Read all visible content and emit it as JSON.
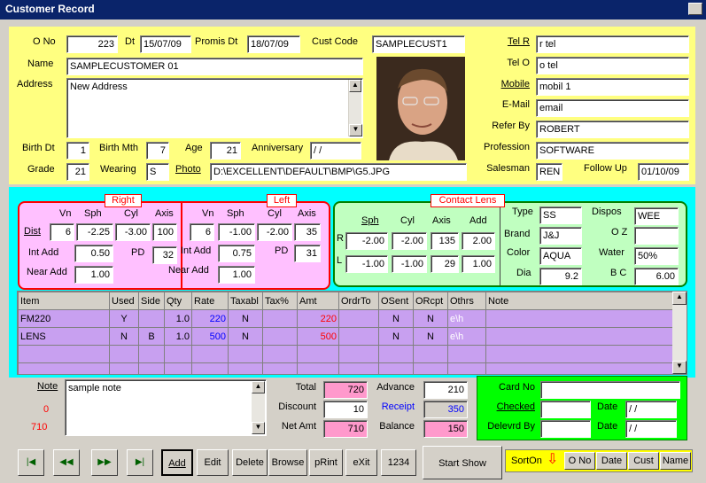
{
  "window": {
    "title": "Customer Record"
  },
  "header": {
    "ono_label": "O No",
    "ono": "223",
    "dt_label": "Dt",
    "dt": "15/07/09",
    "promis_label": "Promis Dt",
    "promis": "18/07/09",
    "cust_code_label": "Cust Code",
    "cust_code": "SAMPLECUST1",
    "name_label": "Name",
    "name": "SAMPLECUSTOMER 01",
    "address_label": "Address",
    "address": "New Address",
    "birth_dt_label": "Birth Dt",
    "birth_dt": "1",
    "birth_mth_label": "Birth Mth",
    "birth_mth": "7",
    "age_label": "Age",
    "age": "21",
    "anniversary_label": "Anniversary",
    "anniversary": " / /",
    "grade_label": "Grade",
    "grade": "21",
    "wearing_label": "Wearing",
    "wearing": "S",
    "photo_label": "Photo",
    "photo": "D:\\EXCELLENT\\DEFAULT\\BMP\\G5.JPG",
    "tel_r_label": "Tel R",
    "tel_r": "r tel",
    "tel_o_label": "Tel O",
    "tel_o": "o tel",
    "mobile_label": "Mobile",
    "mobile": "mobil 1",
    "email_label": "E-Mail",
    "email": "email",
    "refer_label": "Refer By",
    "refer": "ROBERT",
    "profession_label": "Profession",
    "profession": "SOFTWARE",
    "salesman_label": "Salesman",
    "salesman": "REN",
    "follow_label": "Follow Up",
    "follow": "01/10/09"
  },
  "rx": {
    "right_title": "Right",
    "left_title": "Left",
    "cols": [
      "Vn",
      "Sph",
      "Cyl",
      "Axis"
    ],
    "dist_label": "Dist",
    "intadd_label": "Int Add",
    "nearadd_label": "Near Add",
    "pd_label": "PD",
    "right": {
      "vn": "6",
      "sph": "-2.25",
      "cyl": "-3.00",
      "axis": "100",
      "intadd": "0.50",
      "pd": "32",
      "nearadd": "1.00"
    },
    "left": {
      "vn": "6",
      "sph": "-1.00",
      "cyl": "-2.00",
      "axis": "35",
      "intadd": "0.75",
      "pd": "31",
      "nearadd": "1.00"
    }
  },
  "contact": {
    "title": "Contact Lens",
    "cols": [
      "Sph",
      "Cyl",
      "Axis",
      "Add"
    ],
    "r_label": "R",
    "l_label": "L",
    "r": {
      "sph": "-2.00",
      "cyl": "-2.00",
      "axis": "135",
      "add": "2.00"
    },
    "l": {
      "sph": "-1.00",
      "cyl": "-1.00",
      "axis": "29",
      "add": "1.00"
    },
    "type_label": "Type",
    "type": "SS",
    "brand_label": "Brand",
    "brand": "J&J",
    "color_label": "Color",
    "color": "AQUA",
    "dia_label": "Dia",
    "dia": "9.2",
    "dispos_label": "Dispos",
    "dispos": "WEE",
    "oz_label": "O Z",
    "oz": "",
    "water_label": "Water",
    "water": "50%",
    "bc_label": "B C",
    "bc": "6.00"
  },
  "items": {
    "headers": [
      "Item",
      "Used",
      "Side",
      "Qty",
      "Rate",
      "Taxabl",
      "Tax%",
      "Amt",
      "OrdrTo",
      "OSent",
      "ORcpt",
      "Othrs",
      "Note"
    ],
    "rows": [
      [
        "FM220",
        "Y",
        "",
        "1.0",
        "220",
        "N",
        "",
        "220",
        "",
        "N",
        "N",
        "e\\h",
        ""
      ],
      [
        "LENS",
        "N",
        "B",
        "1.0",
        "500",
        "N",
        "",
        "500",
        "",
        "N",
        "N",
        "e\\h",
        ""
      ]
    ]
  },
  "footer": {
    "note_label": "Note",
    "note": "sample note",
    "count1": "0",
    "count2": "710",
    "total_label": "Total",
    "total": "720",
    "discount_label": "Discount",
    "discount": "10",
    "netamt_label": "Net Amt",
    "netamt": "710",
    "advance_label": "Advance",
    "advance": "210",
    "receipt_label": "Receipt",
    "receipt": "350",
    "balance_label": "Balance",
    "balance": "150",
    "cardno_label": "Card No",
    "cardno": "",
    "checked_label": "Checked",
    "checked": "",
    "delevrd_label": "Delevrd By",
    "delevrd": "",
    "date_label": "Date",
    "date1": " / /",
    "date2": " / /"
  },
  "toolbar": {
    "add": "Add",
    "edit": "Edit",
    "delete": "Delete",
    "browse": "Browse",
    "print": "pRint",
    "exit": "eXit",
    "n1234": "1234",
    "start_show": "Start Show",
    "sorton": "SortOn",
    "sort_ono": "O No",
    "sort_date": "Date",
    "sort_cust": "Cust",
    "sort_name": "Name"
  },
  "colors": {
    "yellow": "#ffff80",
    "cyan": "#00ffff",
    "pink": "#ffc0ff",
    "green": "#00ff00",
    "purple": "#c8a0f0"
  }
}
